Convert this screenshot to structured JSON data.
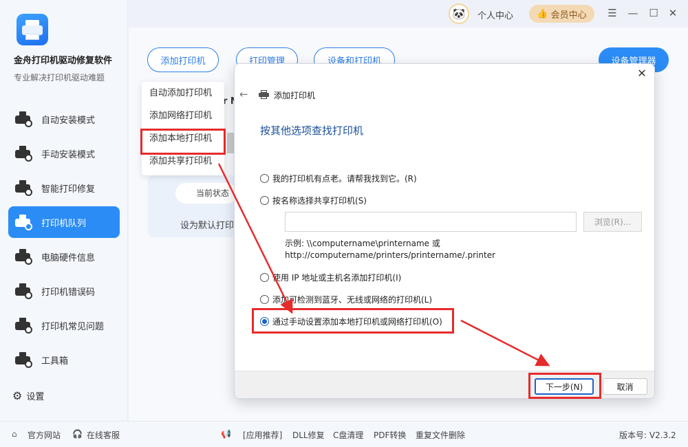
{
  "app": {
    "name": "金舟打印机驱动修复软件",
    "subtitle": "专业解决打印机驱动难题"
  },
  "sidebar": {
    "items": [
      {
        "label": "自动安装模式",
        "icon": "auto-install-icon"
      },
      {
        "label": "手动安装模式",
        "icon": "manual-install-icon"
      },
      {
        "label": "智能打印修复",
        "icon": "smart-repair-icon"
      },
      {
        "label": "打印机队列",
        "icon": "printer-queue-icon",
        "active": true
      },
      {
        "label": "电脑硬件信息",
        "icon": "hardware-info-icon"
      },
      {
        "label": "打印机错误码",
        "icon": "error-code-icon"
      },
      {
        "label": "打印机常见问题",
        "icon": "faq-icon"
      },
      {
        "label": "工具箱",
        "icon": "toolbox-icon"
      }
    ],
    "settings_label": "设置"
  },
  "topbar": {
    "user_center": "个人中心",
    "vip_center": "会员中心"
  },
  "toolbar": {
    "add_printer": "添加打印机",
    "printer_manage": "打印管理",
    "devices_printers": "设备和打印机",
    "device_manager": "设备管理器"
  },
  "dropdown": {
    "items": [
      "自动添加打印机",
      "添加网络打印机",
      "添加本地打印机",
      "添加共享打印机"
    ]
  },
  "background": {
    "status_label": "当前状态",
    "set_default": "设为默认打印",
    "partial_title": "r N"
  },
  "dialog": {
    "title": "添加打印机",
    "heading": "按其他选项查找打印机",
    "options": [
      "我的打印机有点老。请帮我找到它。(R)",
      "按名称选择共享打印机(S)",
      "使用 IP 地址或主机名添加打印机(I)",
      "添加可检测到蓝牙、无线或网络的打印机(L)",
      "通过手动设置添加本地打印机或网络打印机(O)"
    ],
    "selected_index": 4,
    "share_input_value": "",
    "browse_label": "浏览(R)...",
    "example_line1": "示例: \\\\computername\\printername 或",
    "example_line2": "http://computername/printers/printername/.printer",
    "next_label": "下一步(N)",
    "cancel_label": "取消"
  },
  "bottom": {
    "website": "官方网站",
    "support": "在线客服",
    "recommend": "[应用推荐]",
    "links": [
      "DLL修复",
      "C盘清理",
      "PDF转换",
      "重复文件删除"
    ],
    "version": "版本号: V2.3.2"
  },
  "colors": {
    "accent": "#2b8cf5",
    "highlight": "#e62b2b",
    "dialog_heading": "#1a4f9c"
  }
}
